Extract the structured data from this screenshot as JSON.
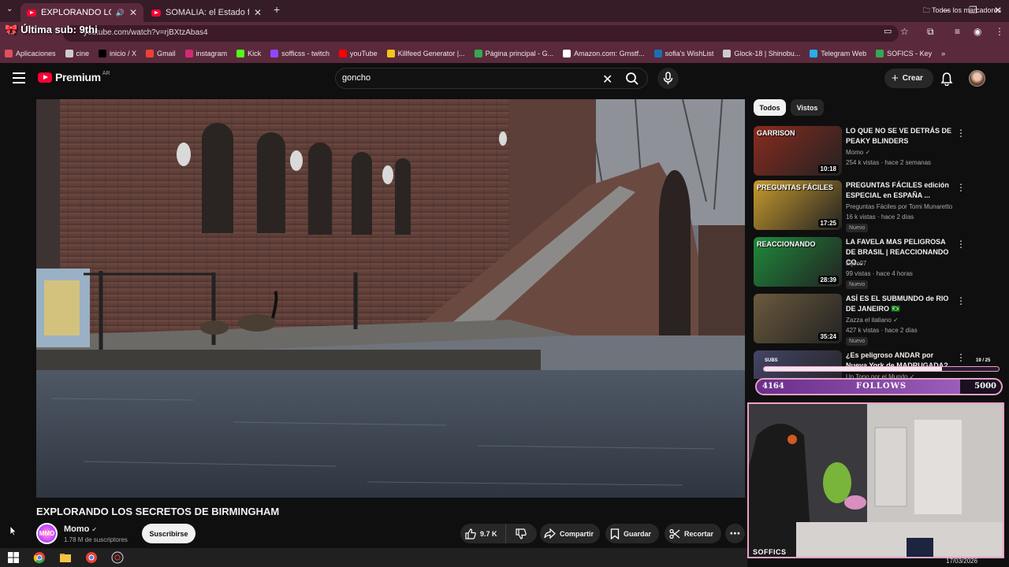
{
  "browser": {
    "tabs": [
      {
        "title": "EXPLORANDO LOS SECRETOS",
        "active": true
      },
      {
        "title": "SOMALIA: el Estado fallido más",
        "active": false
      }
    ],
    "new_tab": "+",
    "url": "youtube.com/watch?v=rjBXtzAbas4",
    "bookmarks": [
      {
        "label": "Aplicaciones",
        "icon": "apps-grid-icon",
        "color": "#e04f5f"
      },
      {
        "label": "cine",
        "icon": "folder-icon",
        "color": "#cccccc"
      },
      {
        "label": "inicio / X",
        "icon": "x-icon",
        "color": "#000000"
      },
      {
        "label": "Gmail",
        "icon": "gmail-icon",
        "color": "#ea4335"
      },
      {
        "label": "instagram",
        "icon": "instagram-icon",
        "color": "#d62976"
      },
      {
        "label": "Kick",
        "icon": "kick-icon",
        "color": "#53fc18"
      },
      {
        "label": "sofficss - twitch",
        "icon": "twitch-icon",
        "color": "#9146ff"
      },
      {
        "label": "youTube",
        "icon": "youtube-icon",
        "color": "#ff0000"
      },
      {
        "label": "Killfeed Generator |...",
        "icon": "killfeed-icon",
        "color": "#f5c518"
      },
      {
        "label": "Página principal - G...",
        "icon": "drive-icon",
        "color": "#34a853"
      },
      {
        "label": "Amazon.com: Grnstf...",
        "icon": "amazon-icon",
        "color": "#ffffff"
      },
      {
        "label": "sofia's WishList",
        "icon": "steam-icon",
        "color": "#1b6fb5"
      },
      {
        "label": "Glock-18 | Shinobu...",
        "icon": "f-icon",
        "color": "#cccccc"
      },
      {
        "label": "Telegram Web",
        "icon": "telegram-icon",
        "color": "#2aabee"
      },
      {
        "label": "SOFICS - Key",
        "icon": "key-icon",
        "color": "#34a853"
      }
    ],
    "all_bookmarks": "Todos los marcadores"
  },
  "stream_overlay": {
    "last_sub": "Última sub: 9thi",
    "subs_label": "SUBS",
    "subs_count": "19 / 25",
    "subs_progress": 0.76,
    "follows_current": "4164",
    "follows_label": "FOLLOWS",
    "follows_goal": "5000",
    "follows_progress": 0.8328,
    "webcam_tag": "SOFFICS"
  },
  "youtube": {
    "logo_word": "Premium",
    "region": "AR",
    "search_value": "goncho",
    "create_label": "Crear",
    "video": {
      "title": "EXPLORANDO LOS SECRETOS DE BIRMINGHAM",
      "channel": "Momo",
      "channel_avatar": "MMO",
      "subscribers": "1.78 M de suscriptores",
      "subscribe_label": "Suscribirse",
      "likes": "9.7 K",
      "share_label": "Compartir",
      "save_label": "Guardar",
      "clip_label": "Recortar"
    },
    "chips": [
      "Todos",
      "Vistos"
    ],
    "recommendations": [
      {
        "title": "LO QUE NO SE VE DETRÁS DE PEAKY BLINDERS",
        "channel": "Momo ✓",
        "meta": "254 k vistas · hace 2 semanas",
        "badge": "",
        "duration": "10:18",
        "thumb_text": "GARRISON",
        "accent": "#8a2b1f"
      },
      {
        "title": "PREGUNTAS FÁCILES edición ESPECIAL en ESPAÑA ...",
        "channel": "Preguntas Fáciles por Tomi Munaretto",
        "meta": "16 k vistas · hace 2 días",
        "badge": "Nuevo",
        "duration": "17:25",
        "thumb_text": "PREGUNTAS FÁCILES",
        "accent": "#c79a2e"
      },
      {
        "title": "LA FAVELA MAS PELIGROSA DE BRASIL | REACCIONANDO CO...",
        "channel": "Eljoc07",
        "meta": "99 vistas · hace 4 horas",
        "badge": "Nuevo",
        "duration": "28:39",
        "thumb_text": "REACCIONANDO",
        "accent": "#1f8a3b"
      },
      {
        "title": "ASÍ ES EL SUBMUNDO de RIO DE JANEIRO 🇧🇷",
        "channel": "Zazza el italiano ✓",
        "meta": "427 k vistas · hace 2 días",
        "badge": "Nuevo",
        "duration": "35:24",
        "thumb_text": "",
        "accent": "#6b5a3e"
      },
      {
        "title": "¿Es peligroso ANDAR por Nueva York de MADRUGADA?",
        "channel": "Un Topo por el Mundo ✓",
        "meta": "",
        "badge": "",
        "duration": "",
        "thumb_text": "",
        "accent": "#444466"
      }
    ]
  },
  "taskbar": {
    "date": "17/03/2026"
  }
}
